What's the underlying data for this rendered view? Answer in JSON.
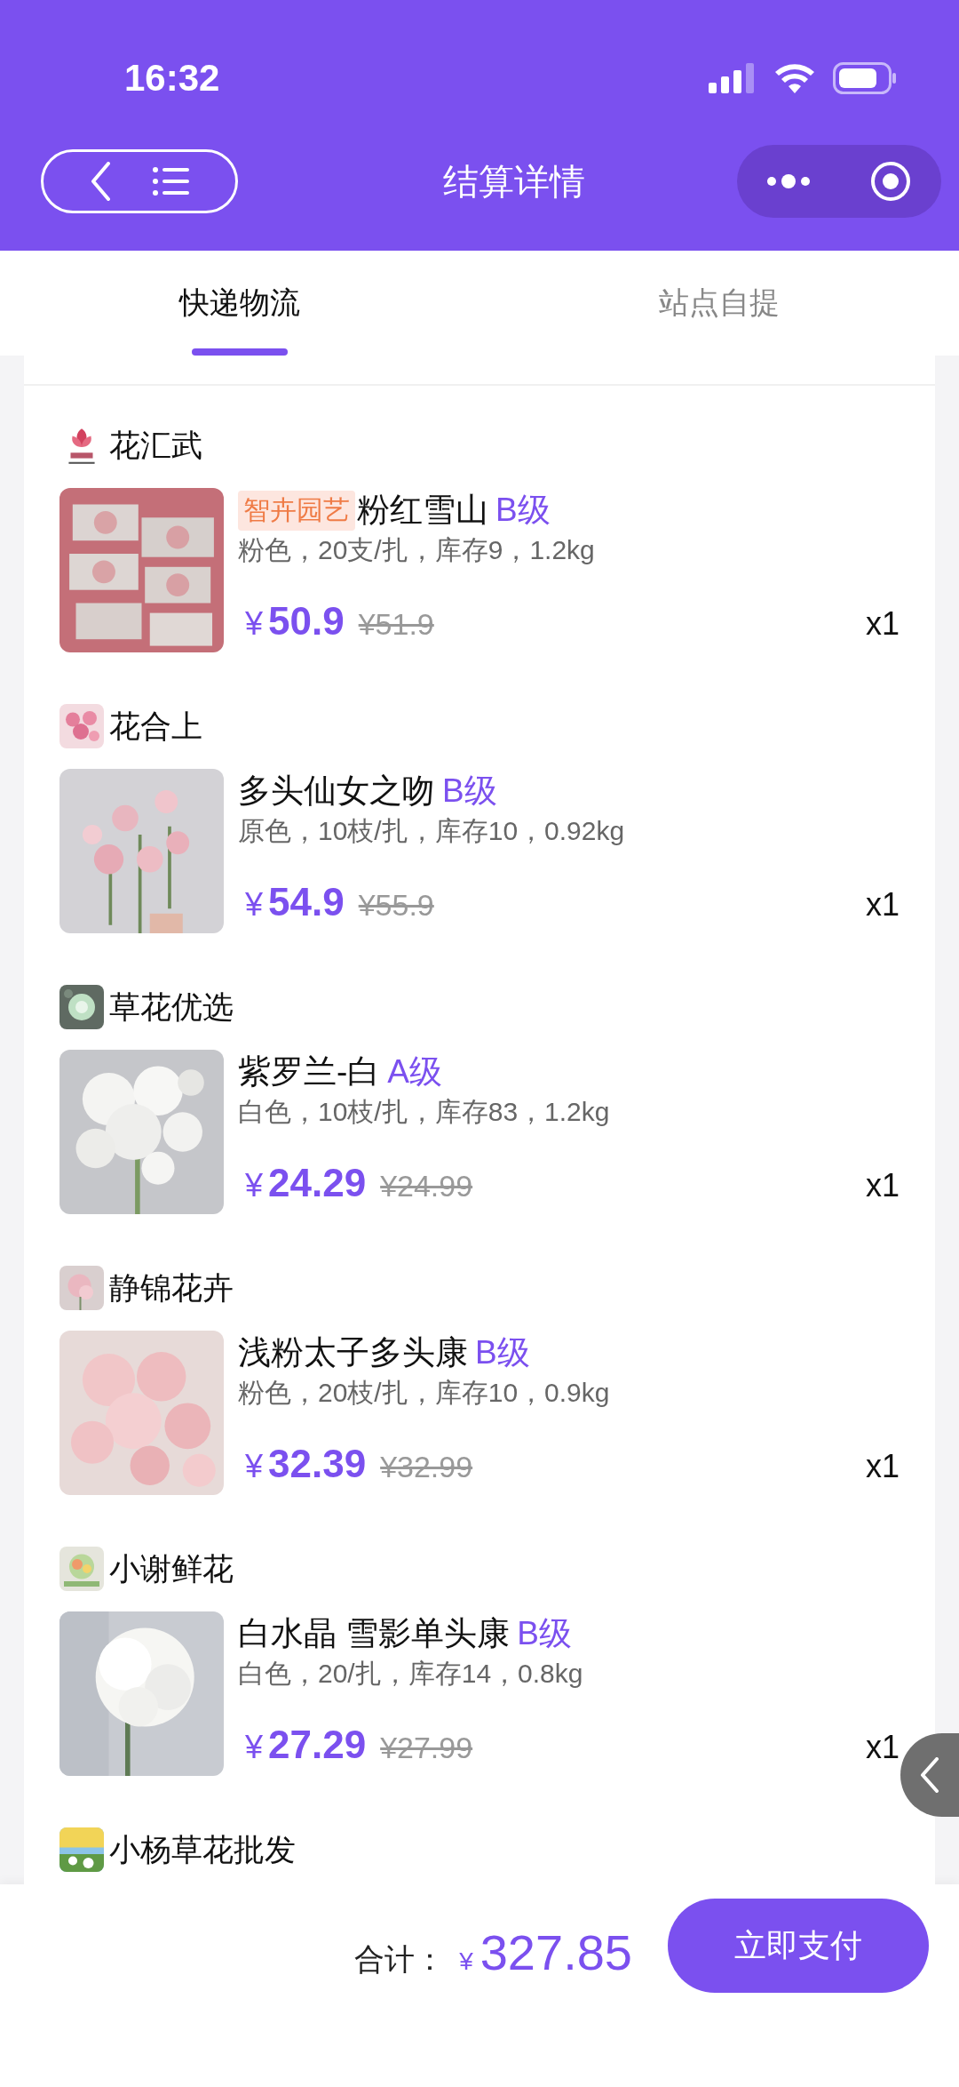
{
  "status_bar": {
    "time": "16:32"
  },
  "nav": {
    "title": "结算详情"
  },
  "tabs": [
    {
      "label": "快递物流",
      "selected": true
    },
    {
      "label": "站点自提",
      "selected": false
    }
  ],
  "shops": [
    {
      "name": "花汇武",
      "products": [
        {
          "tag": "智卉园艺",
          "name": "粉红雪山",
          "grade": "B级",
          "spec": "粉色，20支/扎，库存9，1.2kg",
          "currency": "¥",
          "price": "50.9",
          "original_price": "¥51.9",
          "quantity": "x1"
        }
      ]
    },
    {
      "name": "花合上",
      "products": [
        {
          "name": "多头仙女之吻",
          "grade": "B级",
          "spec": "原色，10枝/扎，库存10，0.92kg",
          "currency": "¥",
          "price": "54.9",
          "original_price": "¥55.9",
          "quantity": "x1"
        }
      ]
    },
    {
      "name": "草花优选",
      "products": [
        {
          "name": "紫罗兰-白",
          "grade": "A级",
          "spec": "白色，10枝/扎，库存83，1.2kg",
          "currency": "¥",
          "price": "24.29",
          "original_price": "¥24.99",
          "quantity": "x1"
        }
      ]
    },
    {
      "name": "静锦花卉",
      "products": [
        {
          "name": "浅粉太子多头康",
          "grade": "B级",
          "spec": "粉色，20枝/扎，库存10，0.9kg",
          "currency": "¥",
          "price": "32.39",
          "original_price": "¥32.99",
          "quantity": "x1"
        }
      ]
    },
    {
      "name": "小谢鲜花",
      "products": [
        {
          "name": "白水晶 雪影单头康",
          "grade": "B级",
          "spec": "白色，20/扎，库存14，0.8kg",
          "currency": "¥",
          "price": "27.29",
          "original_price": "¥27.99",
          "quantity": "x1"
        }
      ]
    },
    {
      "name": "小杨草花批发"
    }
  ],
  "footer": {
    "total_label": "合计：",
    "currency": "¥",
    "total": "327.85",
    "pay_button": "立即支付"
  }
}
